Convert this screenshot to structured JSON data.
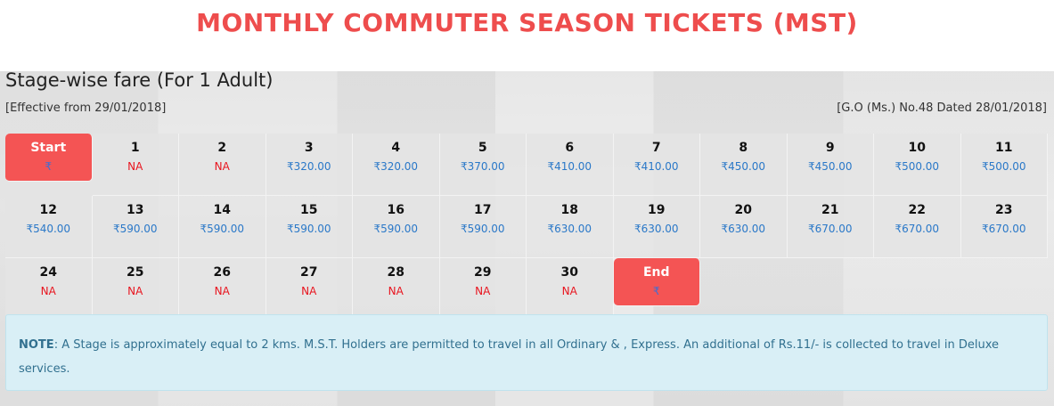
{
  "page": {
    "title": "MONTHLY COMMUTER SEASON TICKETS (MST)",
    "subtitle": "Stage-wise fare (For 1 Adult)",
    "effective": "[Effective from 29/01/2018]",
    "go_ref": "[G.O (Ms.) No.48 Dated 28/01/2018]"
  },
  "colors": {
    "accent_red": "#f45454",
    "price_blue": "#2a78c8",
    "na_red": "#e8141e",
    "note_bg": "#d9eff6"
  },
  "stages": [
    {
      "label": "Start",
      "fare": "₹",
      "type": "start"
    },
    {
      "label": "1",
      "fare": "NA"
    },
    {
      "label": "2",
      "fare": "NA"
    },
    {
      "label": "3",
      "fare": "₹320.00"
    },
    {
      "label": "4",
      "fare": "₹320.00"
    },
    {
      "label": "5",
      "fare": "₹370.00"
    },
    {
      "label": "6",
      "fare": "₹410.00"
    },
    {
      "label": "7",
      "fare": "₹410.00"
    },
    {
      "label": "8",
      "fare": "₹450.00"
    },
    {
      "label": "9",
      "fare": "₹450.00"
    },
    {
      "label": "10",
      "fare": "₹500.00"
    },
    {
      "label": "11",
      "fare": "₹500.00"
    },
    {
      "label": "12",
      "fare": "₹540.00"
    },
    {
      "label": "13",
      "fare": "₹590.00"
    },
    {
      "label": "14",
      "fare": "₹590.00"
    },
    {
      "label": "15",
      "fare": "₹590.00"
    },
    {
      "label": "16",
      "fare": "₹590.00"
    },
    {
      "label": "17",
      "fare": "₹590.00"
    },
    {
      "label": "18",
      "fare": "₹630.00"
    },
    {
      "label": "19",
      "fare": "₹630.00"
    },
    {
      "label": "20",
      "fare": "₹630.00"
    },
    {
      "label": "21",
      "fare": "₹670.00"
    },
    {
      "label": "22",
      "fare": "₹670.00"
    },
    {
      "label": "23",
      "fare": "₹670.00"
    },
    {
      "label": "24",
      "fare": "NA"
    },
    {
      "label": "25",
      "fare": "NA"
    },
    {
      "label": "26",
      "fare": "NA"
    },
    {
      "label": "27",
      "fare": "NA"
    },
    {
      "label": "28",
      "fare": "NA"
    },
    {
      "label": "29",
      "fare": "NA"
    },
    {
      "label": "30",
      "fare": "NA"
    },
    {
      "label": "End",
      "fare": "₹",
      "type": "end"
    }
  ],
  "note": {
    "label": "NOTE",
    "text": ": A Stage is approximately equal to 2 kms. M.S.T. Holders are permitted to travel in all Ordinary & , Express. An additional of Rs.11/- is collected to travel in Deluxe services."
  }
}
